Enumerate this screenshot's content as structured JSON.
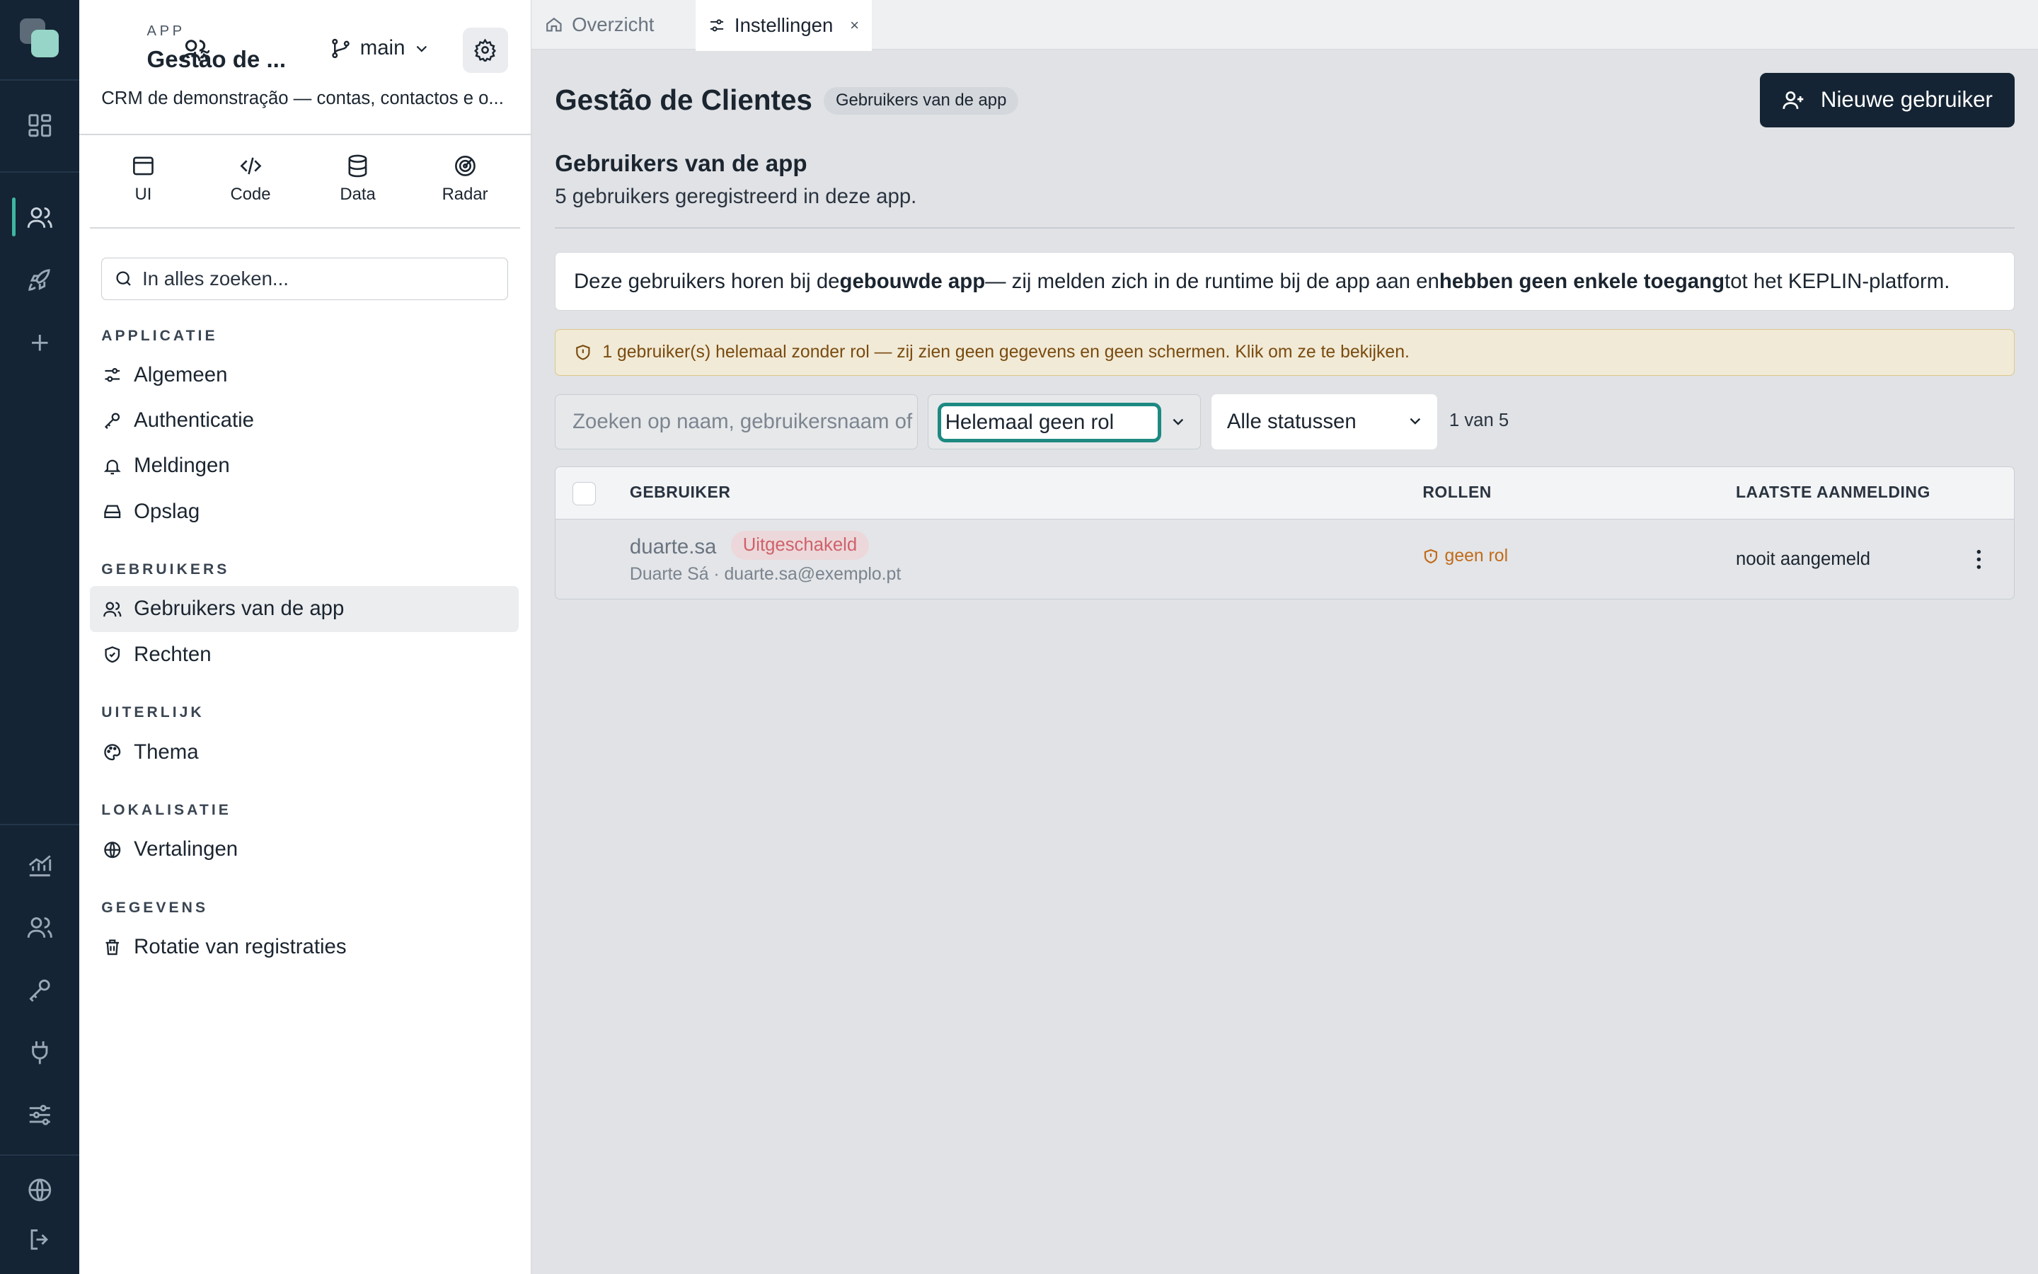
{
  "app": {
    "label": "APP",
    "title": "Gestão de ...",
    "branch": "main",
    "description": "CRM de demonstração — contas, contactos e o..."
  },
  "modes": [
    {
      "label": "UI",
      "icon": "window-icon"
    },
    {
      "label": "Code",
      "icon": "code-icon"
    },
    {
      "label": "Data",
      "icon": "database-icon"
    },
    {
      "label": "Radar",
      "icon": "radar-icon"
    }
  ],
  "search": {
    "placeholder": "In alles zoeken..."
  },
  "sidebar": {
    "sections": [
      {
        "title": "APPLICATIE",
        "items": [
          {
            "label": "Algemeen",
            "icon": "sliders-icon"
          },
          {
            "label": "Authenticatie",
            "icon": "key-icon"
          },
          {
            "label": "Meldingen",
            "icon": "bell-icon"
          },
          {
            "label": "Opslag",
            "icon": "storage-icon"
          }
        ]
      },
      {
        "title": "GEBRUIKERS",
        "items": [
          {
            "label": "Gebruikers van de app",
            "icon": "users-icon",
            "active": true
          },
          {
            "label": "Rechten",
            "icon": "shield-icon"
          }
        ]
      },
      {
        "title": "UITERLIJK",
        "items": [
          {
            "label": "Thema",
            "icon": "palette-icon"
          }
        ]
      },
      {
        "title": "LOKALISATIE",
        "items": [
          {
            "label": "Vertalingen",
            "icon": "globe-icon"
          }
        ]
      },
      {
        "title": "GEGEVENS",
        "items": [
          {
            "label": "Rotatie van registraties",
            "icon": "trash-icon"
          }
        ]
      }
    ]
  },
  "tabs": [
    {
      "label": "Overzicht",
      "icon": "home-icon"
    },
    {
      "label": "Instellingen",
      "icon": "sliders-icon",
      "active": true,
      "close": "×"
    }
  ],
  "page": {
    "title": "Gestão de Clientes",
    "badge": "Gebruikers van de app",
    "new_button": "Nieuwe gebruiker",
    "subtitle": "Gebruikers van de app",
    "subdesc": "5 gebruikers geregistreerd in deze app.",
    "info": {
      "p1": "Deze gebruikers horen bij de ",
      "b1": "gebouwde app",
      "p2": " — zij melden zich in de runtime bij de app aan en ",
      "b2": "hebben geen enkele toegang",
      "p3": " tot het KEPLIN-platform."
    },
    "warning": "1 gebruiker(s) helemaal zonder rol — zij zien geen gegevens en geen schermen. Klik om ze te bekijken."
  },
  "filters": {
    "search_placeholder": "Zoeken op naam, gebruikersnaam of e-mail",
    "role_value": "Helemaal geen rol",
    "status_value": "Alle statussen",
    "count": "1 van 5"
  },
  "table": {
    "headers": [
      "GEBRUIKER",
      "ROLLEN",
      "LAATSTE AANMELDING"
    ],
    "rows": [
      {
        "username": "duarte.sa",
        "status": "Uitgeschakeld",
        "meta": "Duarte Sá · duarte.sa@exemplo.pt",
        "role": "geen rol",
        "last_login": "nooit aangemeld"
      }
    ]
  },
  "colors": {
    "rail_bg": "#142434",
    "accent": "#3fb6a0",
    "focus_ring": "#1d8a82",
    "warning_bg": "#f1ead6",
    "danger_text": "#d0616a",
    "role_warning": "#c26a18"
  }
}
